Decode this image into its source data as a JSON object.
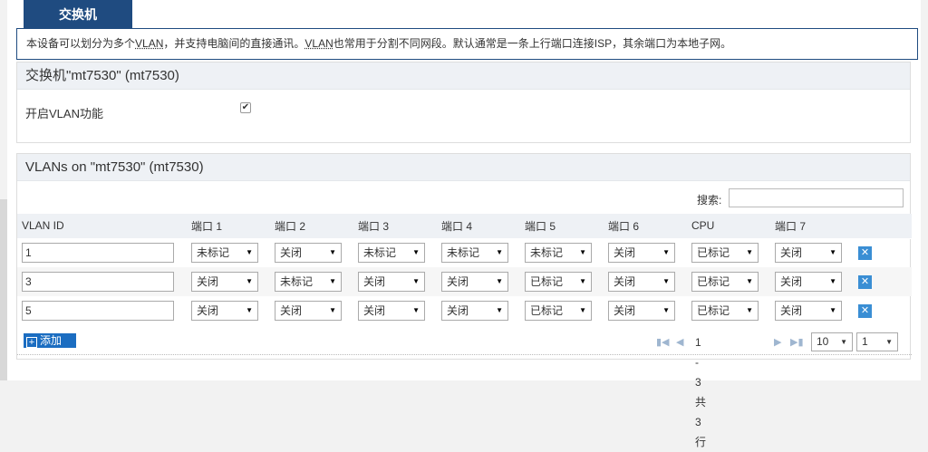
{
  "tab": {
    "label": "交换机"
  },
  "description": {
    "part1": "本设备可以划分为多个",
    "abbr1": "VLAN",
    "part2": "，并支持电脑间的直接通讯。",
    "abbr2": "VLAN",
    "part3": "也常用于分割不同网段。默认通常是一条上行端口连接ISP，其余端口为本地子网。"
  },
  "switch_panel": {
    "title": "交换机\"mt7530\" (mt7530)",
    "enable_vlan_label": "开启VLAN功能",
    "enable_vlan_checked": true
  },
  "vlan_panel": {
    "title": "VLANs on \"mt7530\" (mt7530)",
    "search_label": "搜索:",
    "search_value": "",
    "columns": [
      "VLAN ID",
      "端口 1",
      "端口 2",
      "端口 3",
      "端口 4",
      "端口 5",
      "端口 6",
      "CPU",
      "端口 7"
    ],
    "rows": [
      {
        "vlan_id": "1",
        "ports": [
          "未标记",
          "关闭",
          "未标记",
          "未标记",
          "未标记",
          "关闭",
          "已标记",
          "关闭"
        ]
      },
      {
        "vlan_id": "3",
        "ports": [
          "关闭",
          "未标记",
          "关闭",
          "关闭",
          "已标记",
          "关闭",
          "已标记",
          "关闭"
        ]
      },
      {
        "vlan_id": "5",
        "ports": [
          "关闭",
          "关闭",
          "关闭",
          "关闭",
          "已标记",
          "关闭",
          "已标记",
          "关闭"
        ]
      }
    ],
    "add_label": "添加",
    "pager": {
      "range_text": "1 - 3 共 3 行",
      "page_size": "10",
      "page": "1"
    }
  },
  "colors": {
    "header_blue": "#1f4b80",
    "delete_blue": "#3a8ed4",
    "add_blue": "#1b6dc1"
  }
}
